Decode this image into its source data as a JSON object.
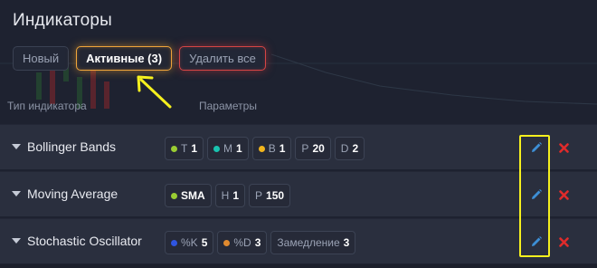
{
  "title": "Индикаторы",
  "tabs": [
    {
      "label": "Новый",
      "state": "normal"
    },
    {
      "label": "Активные (3)",
      "state": "active"
    },
    {
      "label": "Удалить все",
      "state": "danger"
    }
  ],
  "columns": {
    "type": "Тип индикатора",
    "params": "Параметры"
  },
  "indicators": [
    {
      "name": "Bollinger Bands",
      "params": [
        {
          "dot": "#9acd32",
          "label": "T",
          "value": "1"
        },
        {
          "dot": "#19c3b0",
          "label": "M",
          "value": "1"
        },
        {
          "dot": "#f2b51c",
          "label": "B",
          "value": "1"
        },
        {
          "dot": null,
          "label": "P",
          "value": "20"
        },
        {
          "dot": null,
          "label": "D",
          "value": "2"
        }
      ]
    },
    {
      "name": "Moving Average",
      "params": [
        {
          "dot": "#9acd32",
          "label": "",
          "value": "SMA"
        },
        {
          "dot": null,
          "label": "H",
          "value": "1"
        },
        {
          "dot": null,
          "label": "P",
          "value": "150"
        }
      ]
    },
    {
      "name": "Stochastic Oscillator",
      "params": [
        {
          "dot": "#2f55e0",
          "label": "%K",
          "value": "5"
        },
        {
          "dot": "#e08a2f",
          "label": "%D",
          "value": "3"
        },
        {
          "dot": null,
          "label": "Замедление",
          "value": "3"
        }
      ]
    }
  ],
  "icons": {
    "edit": "pencil-icon",
    "delete": "close-icon",
    "row_toggle": "caret-down-icon"
  },
  "colors": {
    "accent": "#f0a53a",
    "danger": "#d64545",
    "edit": "#3d8fd6",
    "delete": "#e02b2b",
    "annotation": "#f5f01e"
  }
}
